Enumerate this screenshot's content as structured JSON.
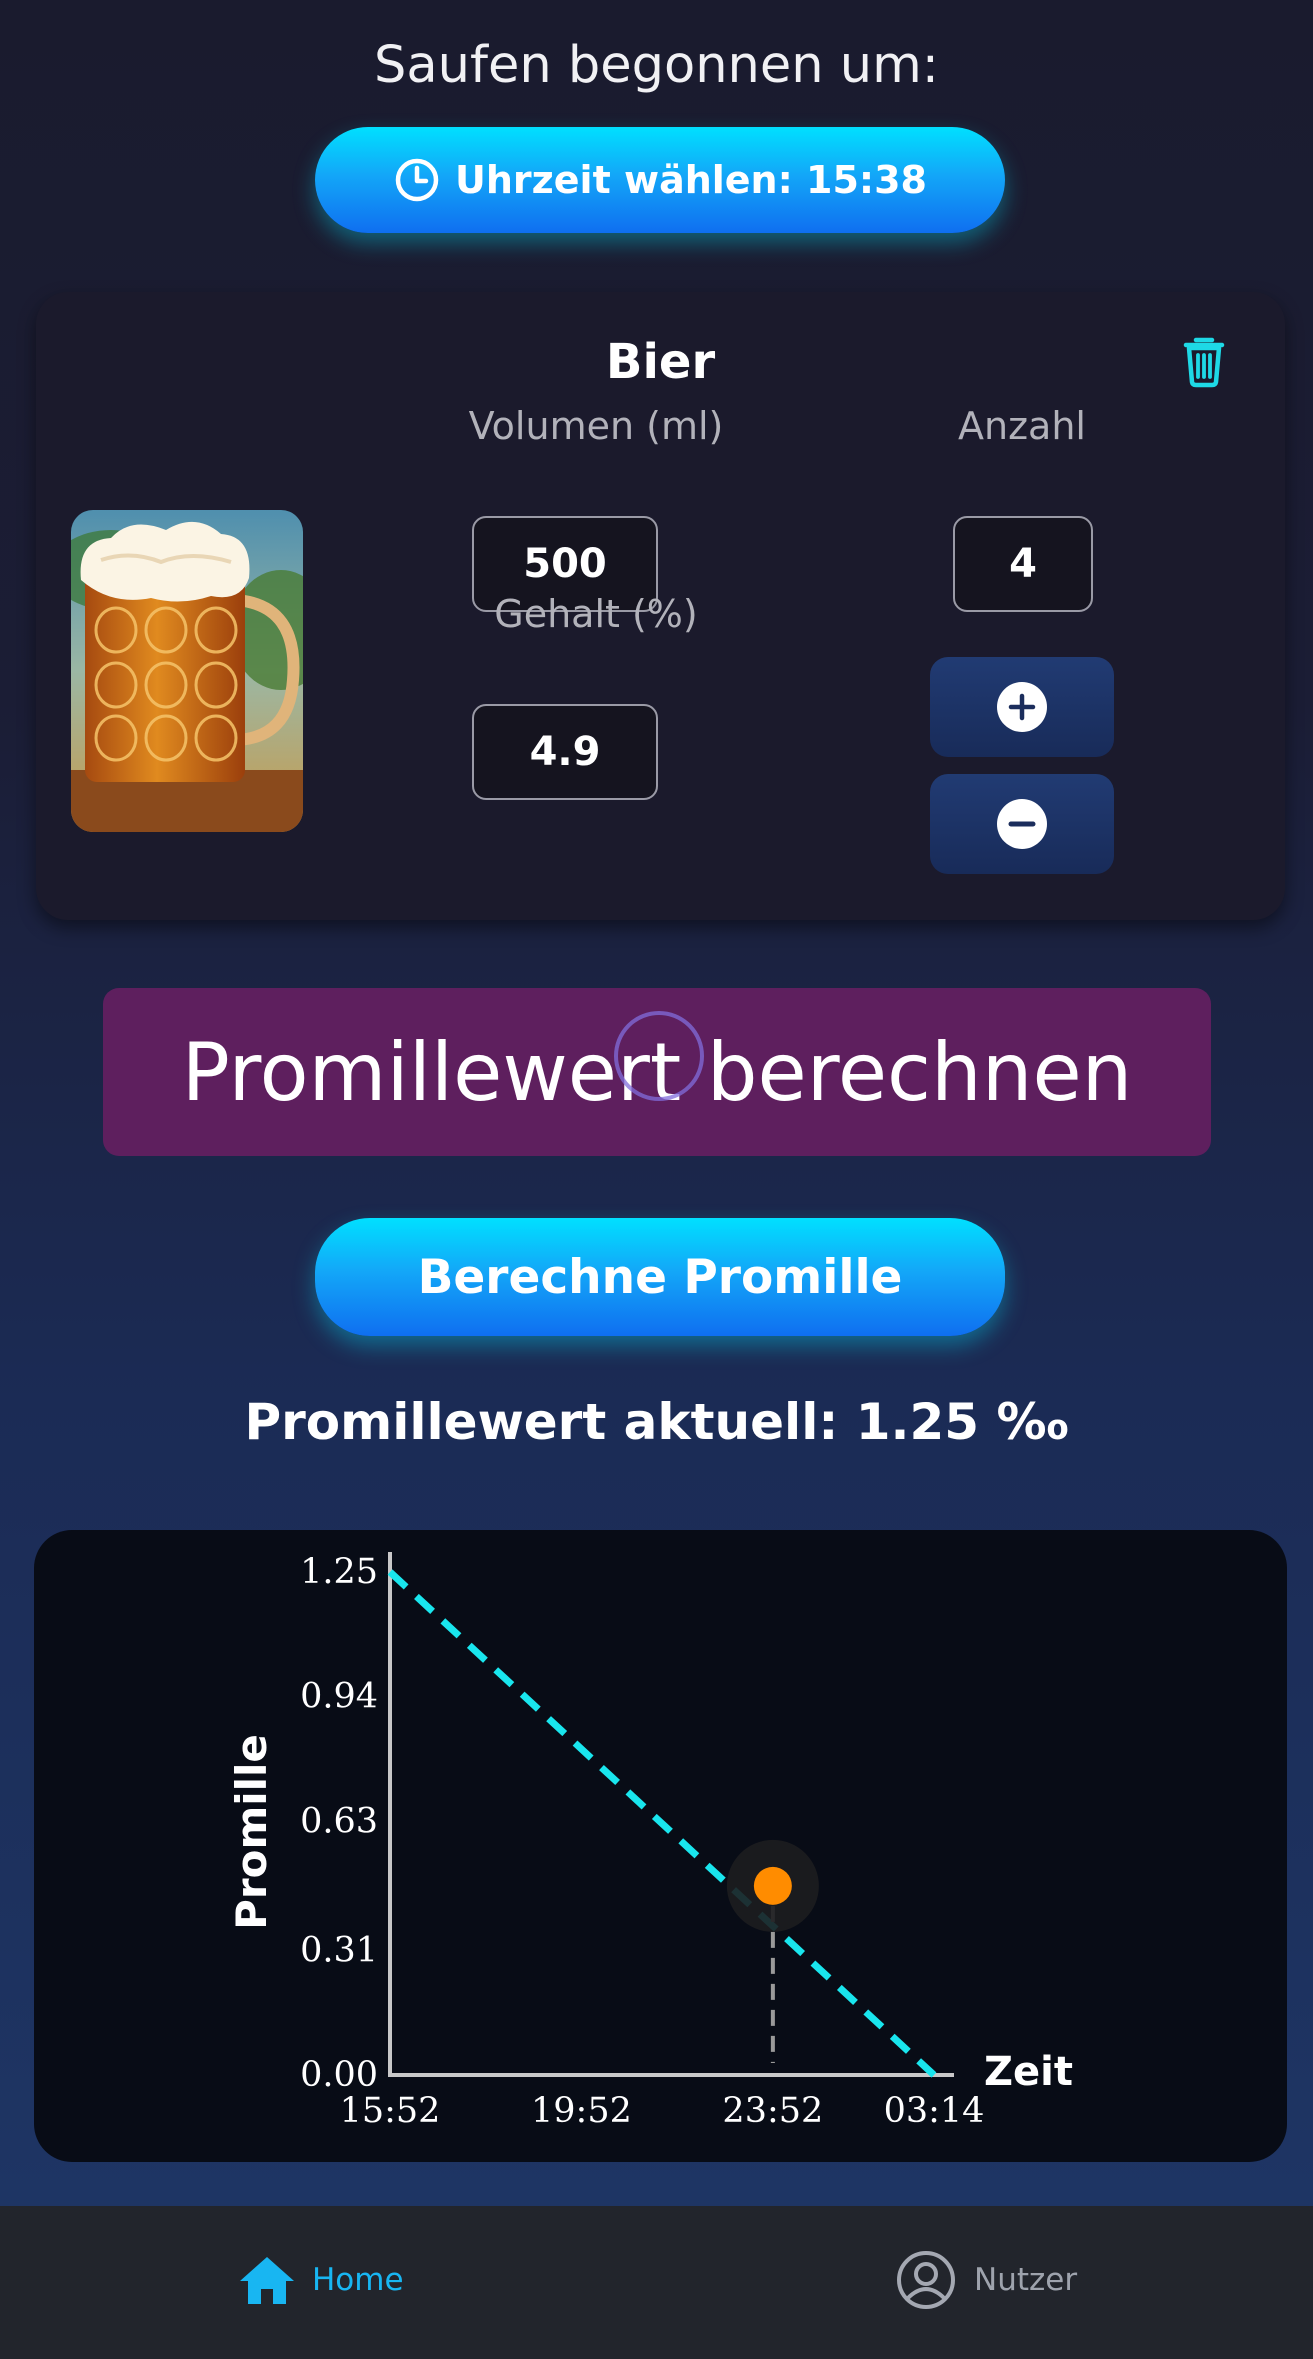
{
  "header": {
    "title": "Saufen begonnen um:",
    "time_button_label": "Uhrzeit wählen: 15:38"
  },
  "drink_card": {
    "name": "Bier",
    "volume_label": "Volumen (ml)",
    "volume_value": "500",
    "content_label": "Gehalt (%)",
    "content_value": "4.9",
    "count_label": "Anzahl",
    "count_value": "4"
  },
  "banner": {
    "text": "Promillewert berechnen"
  },
  "calculate_button_label": "Berechne Promille",
  "result_text": "Promillewert aktuell: 1.25 ‰",
  "chart_data": {
    "type": "line",
    "xlabel": "Zeit",
    "ylabel": "Promille",
    "x_tick_labels": [
      "15:52",
      "19:52",
      "23:52",
      "03:14"
    ],
    "y_tick_labels": [
      "1.25",
      "0.94",
      "0.63",
      "0.31",
      "0.00"
    ],
    "ylim": [
      0,
      1.25
    ],
    "xlim": [
      "15:52",
      "03:14"
    ],
    "series": [
      {
        "style": "dashed",
        "color": "#19e6ee",
        "x": [
          "15:52",
          "03:14"
        ],
        "values": [
          1.25,
          0.0
        ]
      }
    ],
    "marker": {
      "x": "23:52",
      "y": 0.47,
      "color": "#ff8c00"
    },
    "grid": false
  },
  "nav": {
    "home_label": "Home",
    "user_label": "Nutzer"
  },
  "colors": {
    "accent_cyan": "#19c3ff",
    "banner_purple": "#5e1f5e",
    "nav_active": "#18b6f2",
    "nav_inactive": "#9ea3ad"
  }
}
